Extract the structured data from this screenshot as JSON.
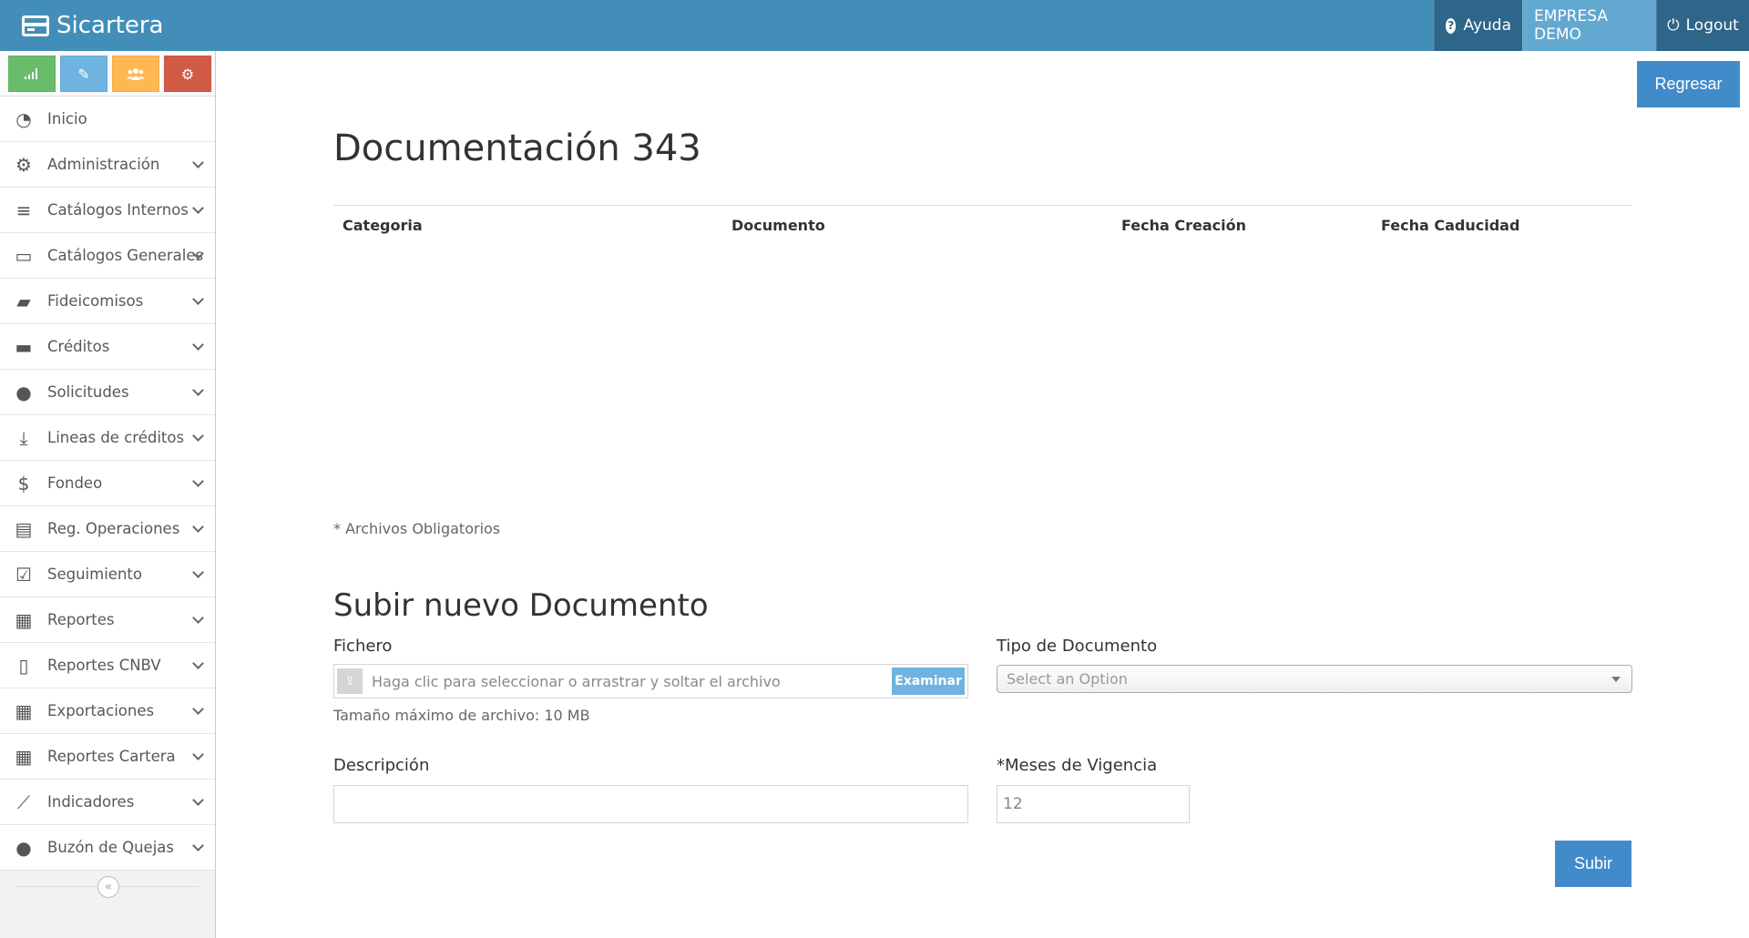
{
  "brand": {
    "name": "Sicartera",
    "icon": "credit-card-icon"
  },
  "header": {
    "help_label": "Ayuda",
    "company_label": "EMPRESA DEMO",
    "logout_label": "Logout"
  },
  "colors": {
    "navbar": "#438eb9",
    "navbar_dark": "#2e6589",
    "company_bg": "#62a8d1",
    "primary_button": "#428bca",
    "shortcut_green": "#68bc6a",
    "shortcut_blue": "#6fb3e0",
    "shortcut_orange": "#ffb752",
    "shortcut_red": "#d15b47"
  },
  "shortcuts": [
    {
      "icon": "signal-bars-icon"
    },
    {
      "icon": "pencil-icon"
    },
    {
      "icon": "users-icon"
    },
    {
      "icon": "cogs-icon"
    }
  ],
  "sidebar": {
    "items": [
      {
        "label": "Inicio",
        "icon": "dashboard-icon"
      },
      {
        "label": "Administración",
        "icon": "cogs-icon"
      },
      {
        "label": "Catálogos Internos",
        "icon": "database-icon"
      },
      {
        "label": "Catálogos Generales",
        "icon": "desktop-icon"
      },
      {
        "label": "Fideicomisos",
        "icon": "folder-open-icon"
      },
      {
        "label": "Créditos",
        "icon": "briefcase-icon"
      },
      {
        "label": "Solicitudes",
        "icon": "user-icon"
      },
      {
        "label": "Lineas de créditos",
        "icon": "download-tray-icon"
      },
      {
        "label": "Fondeo",
        "icon": "dollar-icon"
      },
      {
        "label": "Reg. Operaciones",
        "icon": "file-text-icon"
      },
      {
        "label": "Seguimiento",
        "icon": "check-square-icon"
      },
      {
        "label": "Reportes",
        "icon": "file-excel-icon"
      },
      {
        "label": "Reportes CNBV",
        "icon": "file-icon"
      },
      {
        "label": "Exportaciones",
        "icon": "file-excel-icon"
      },
      {
        "label": "Reportes Cartera",
        "icon": "file-excel-icon"
      },
      {
        "label": "Indicadores",
        "icon": "line-chart-icon"
      },
      {
        "label": "Buzón de Quejas",
        "icon": "comment-icon"
      }
    ]
  },
  "main": {
    "back_button": "Regresar",
    "title": "Documentación 343",
    "table_headers": [
      "Categoria",
      "Documento",
      "Fecha Creación",
      "Fecha Caducidad"
    ],
    "required_note": "* Archivos Obligatorios",
    "upload_section": {
      "title": "Subir nuevo Documento",
      "file_label": "Fichero",
      "file_placeholder": "Haga clic para seleccionar o arrastrar y soltar el archivo",
      "browse_label": "Examinar",
      "max_size_hint": "Tamaño máximo de archivo: 10 MB",
      "doc_type_label": "Tipo de Documento",
      "doc_type_value": "Select an Option",
      "description_label": "Descripción",
      "description_value": "",
      "months_label": "*Meses de Vigencia",
      "months_value": "12",
      "submit_label": "Subir"
    }
  }
}
